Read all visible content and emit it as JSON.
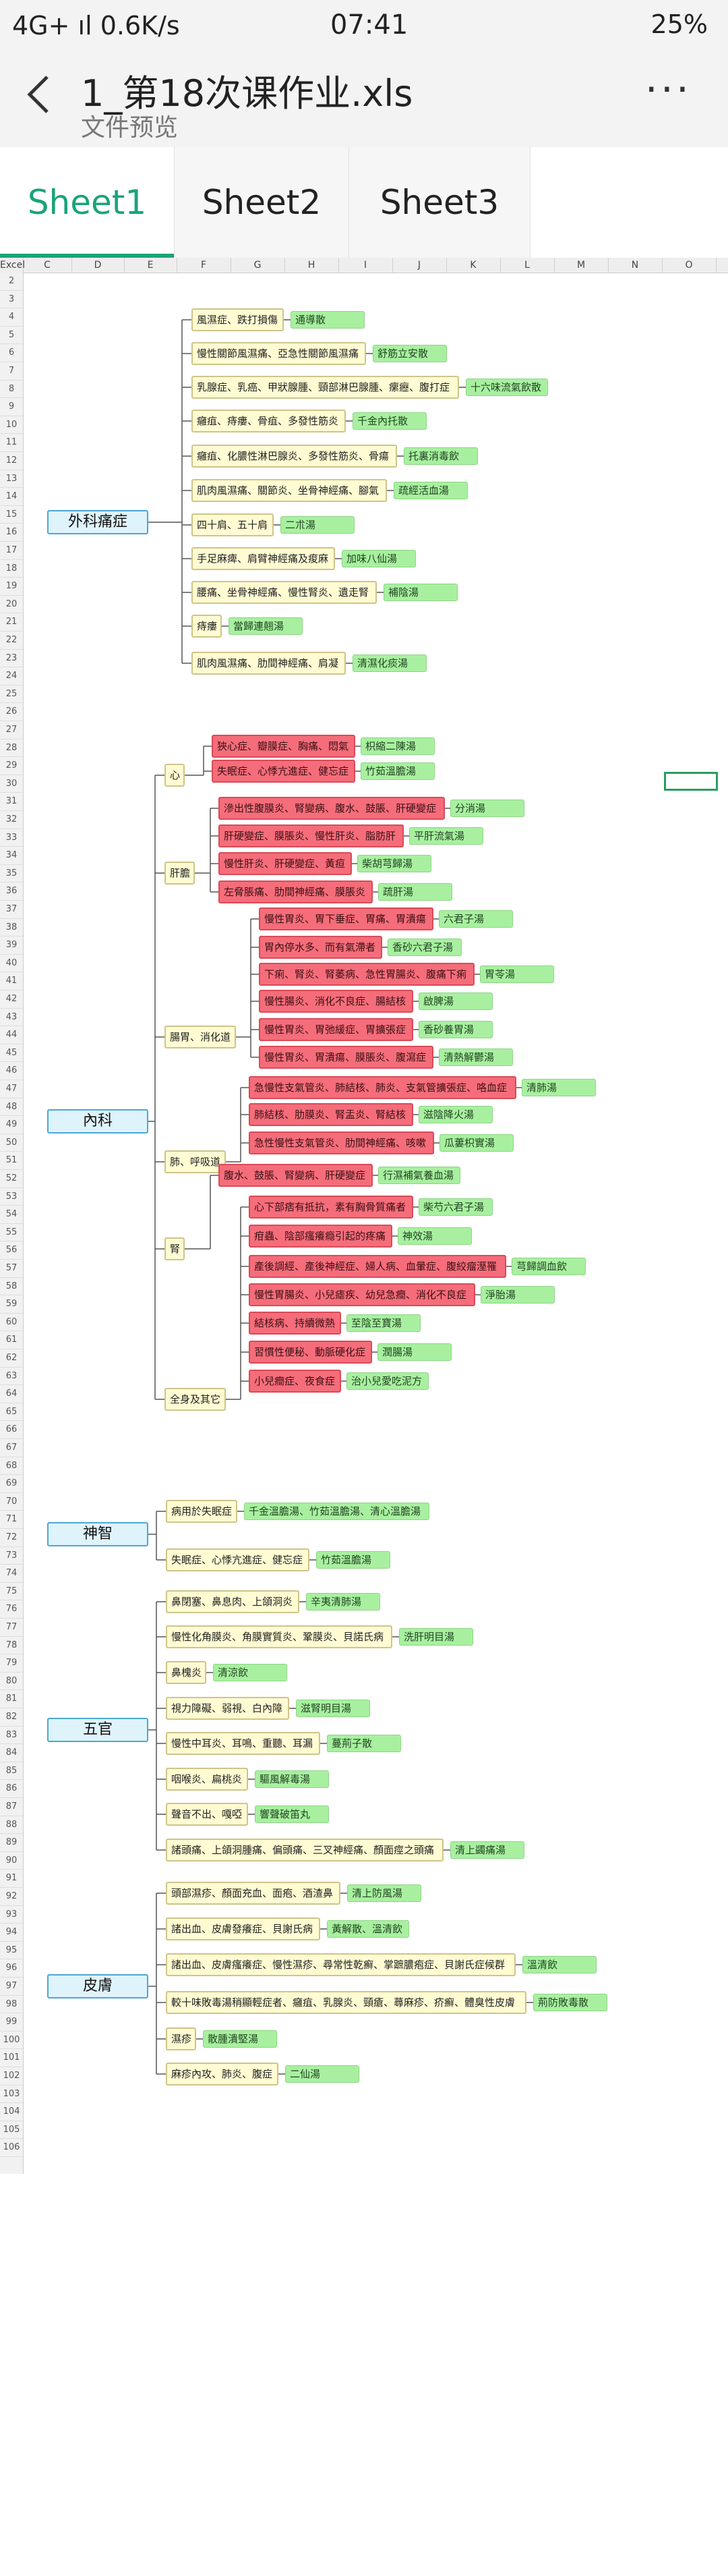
{
  "status_bar": {
    "left": "4G+ ıl 0.6K/s",
    "time": "07:41",
    "battery": "25%"
  },
  "titlebar": {
    "back_icon": "back-arrow-icon",
    "title": "1_第18次课作业.xls",
    "subtitle": "文件预览",
    "more_icon": "more-icon",
    "more_glyph": "···"
  },
  "tabs": [
    "Sheet1",
    "Sheet2",
    "Sheet3"
  ],
  "active_tab": "Sheet1",
  "columns": [
    "Excel",
    "C",
    "D",
    "E",
    "F",
    "G",
    "H",
    "I",
    "J",
    "K",
    "L",
    "M",
    "N",
    "O"
  ],
  "rows": [
    "2",
    "3",
    "4",
    "5",
    "6",
    "7",
    "8",
    "9",
    "10",
    "11",
    "12",
    "13",
    "14",
    "15",
    "16",
    "17",
    "18",
    "19",
    "20",
    "21",
    "22",
    "23",
    "24",
    "25",
    "26",
    "27",
    "28",
    "29",
    "30",
    "31",
    "32",
    "33",
    "34",
    "35",
    "36",
    "37",
    "38",
    "39",
    "40",
    "41",
    "42",
    "43",
    "44",
    "45",
    "46",
    "47",
    "48",
    "49",
    "50",
    "51",
    "52",
    "53",
    "54",
    "55",
    "56",
    "57",
    "58",
    "59",
    "60",
    "61",
    "62",
    "63",
    "64",
    "65",
    "66",
    "67",
    "68",
    "69",
    "70",
    "71",
    "72",
    "73",
    "74",
    "75",
    "76",
    "77",
    "78",
    "79",
    "80",
    "81",
    "82",
    "83",
    "84",
    "85",
    "86",
    "87",
    "88",
    "89",
    "90",
    "91",
    "92",
    "93",
    "94",
    "95",
    "96",
    "97",
    "98",
    "99",
    "100",
    "101",
    "102",
    "103",
    "104",
    "105",
    "106"
  ],
  "roots": [
    "外科痛症",
    "內科",
    "神智",
    "五官",
    "皮膚"
  ],
  "mindmap": {
    "surgery": [
      [
        "風濕症、跌打損傷",
        "通導散"
      ],
      [
        "慢性關節風濕痛、亞急性關節風濕痛",
        "舒筋立安散"
      ],
      [
        "乳腺症、乳癌、甲狀腺腫、頸部淋巴腺腫、瘰癧、腹打症",
        "十六味流氣飲散"
      ],
      [
        "癰疽、痔瘻、骨疽、多發性筋炎",
        "千金內托散"
      ],
      [
        "癰疽、化膿性淋巴腺炎、多發性筋炎、骨瘍",
        "托裏消毒飲"
      ],
      [
        "肌肉風濕痛、關節炎、坐骨神經痛、腳氣",
        "疏經活血湯"
      ],
      [
        "四十肩、五十肩",
        "二朮湯"
      ],
      [
        "手足麻痺、肩臂神經痛及痠麻",
        "加味八仙湯"
      ],
      [
        "腰痛、坐骨神經痛、慢性腎炎、遺走腎",
        "補陰湯"
      ],
      [
        "痔瘻",
        "當歸連翹湯"
      ],
      [
        "肌肉風濕痛、肋間神經痛、肩凝",
        "清濕化痰湯"
      ]
    ],
    "internal_groups": [
      "心",
      "肝膽",
      "腸胃、消化道",
      "肺、呼吸道",
      "腎",
      "全身及其它"
    ],
    "internal": [
      [
        0,
        "狹心症、瓣膜症、胸痛、悶氣",
        "枳縮二陳湯"
      ],
      [
        0,
        "失眠症、心悸亢進症、健忘症",
        "竹茹溫膽湯"
      ],
      [
        1,
        "滲出性腹膜炎、腎變病、腹水、鼓脹、肝硬變症",
        "分消湯"
      ],
      [
        1,
        "肝硬變症、膜脹炎、慢性肝炎、脂肪肝",
        "平肝流氣湯"
      ],
      [
        1,
        "慢性肝炎、肝硬變症、黃疸",
        "柴胡芎歸湯"
      ],
      [
        1,
        "左脅脹痛、肋間神經痛、膜脹炎",
        "疏肝湯"
      ],
      [
        2,
        "慢性胃炎、胃下垂症、胃痛、胃潰瘍",
        "六君子湯"
      ],
      [
        2,
        "胃內停水多、而有氣滯者",
        "香砂六君子湯"
      ],
      [
        2,
        "下痢、腎炎、腎萎病、急性胃腸炎、腹痛下痢",
        "胃苓湯"
      ],
      [
        2,
        "慢性腸炎、消化不良症、腸結核",
        "啟脾湯"
      ],
      [
        2,
        "慢性胃炎、胃弛緩症、胃擴張症",
        "香砂養胃湯"
      ],
      [
        2,
        "慢性胃炎、胃潰瘍、膜脹炎、腹瀉症",
        "清熱解鬱湯"
      ],
      [
        3,
        "急慢性支氣管炎、肺結核、肺炎、支氣管擴張症、咯血症",
        "清肺湯"
      ],
      [
        3,
        "肺結核、肋膜炎、腎盂炎、腎結核",
        "滋陰降火湯"
      ],
      [
        3,
        "急性慢性支氣管炎、肋間神經痛、咳嗽",
        "瓜蔞枳實湯"
      ],
      [
        4,
        "腹水、鼓脹、腎變病、肝硬變症",
        "行濕補氣養血湯"
      ],
      [
        5,
        "心下部痞有抵抗，素有胸骨質痛者",
        "柴芍六君子湯"
      ],
      [
        5,
        "疳蟲、陰部瘙癢瘾引起的疼痛",
        "神效湯"
      ],
      [
        5,
        "產後調經、產後神經症、婦人病、血暈症、腹絞瘤溼罹",
        "芎歸調血飲"
      ],
      [
        5,
        "慢性胃腸炎、小兒瘧疾、幼兒急癎、消化不良症",
        "淨胎湯"
      ],
      [
        5,
        "結核病、持續微熱",
        "至陰至寶湯"
      ],
      [
        5,
        "習慣性便秘、動脈硬化症",
        "潤腸湯"
      ],
      [
        5,
        "小兒癎症、夜食症",
        "治小兒愛吃泥方"
      ]
    ],
    "mind": [
      [
        "病用於失眠症",
        "千金溫膽湯、竹茹溫膽湯、清心溫膽湯"
      ],
      [
        "失眠症、心悸亢進症、健忘症",
        "竹茹溫膽湯"
      ]
    ],
    "senses": [
      [
        "鼻閉塞、鼻息肉、上頜洞炎",
        "辛夷清肺湯"
      ],
      [
        "慢性化角膜炎、角膜實質炎、鞏膜炎、貝諾氏病",
        "洗肝明目湯"
      ],
      [
        "鼻槐炎",
        "清涼飲"
      ],
      [
        "視力障礙、弱視、白內障",
        "滋腎明目湯"
      ],
      [
        "慢性中耳炎、耳鳴、重聽、耳漏",
        "蔓荊子散"
      ],
      [
        "咽喉炎、扁桃炎",
        "驅風解毒湯"
      ],
      [
        "聲音不出、嘎啞",
        "響聲破笛丸"
      ],
      [
        "諸頭痛、上頜洞腫痛、偏頭痛、三叉神經痛、顏面痙之頭痛",
        "清上蠲痛湯"
      ]
    ],
    "skin": [
      [
        "頭部濕疹、顏面充血、面疱、酒渣鼻",
        "清上防風湯"
      ],
      [
        "諸出血、皮膚發癢症、貝謝氏病",
        "黃解散、溫清飲"
      ],
      [
        "諸出血、皮膚瘙癢症、慢性濕疹、尋常性乾癬、掌蹠膿疱症、貝謝氏症候群",
        "溫清飲"
      ],
      [
        "較十味敗毒湯稍顯輕症者、癰疽、乳腺炎、頸瘡、蕁麻疹、疥癬、體臭性皮膚",
        "荊防敗毒散"
      ],
      [
        "濕疹",
        "散腫潰堅湯"
      ],
      [
        "麻疹內攻、肺炎、腹症",
        "二仙湯"
      ]
    ]
  }
}
